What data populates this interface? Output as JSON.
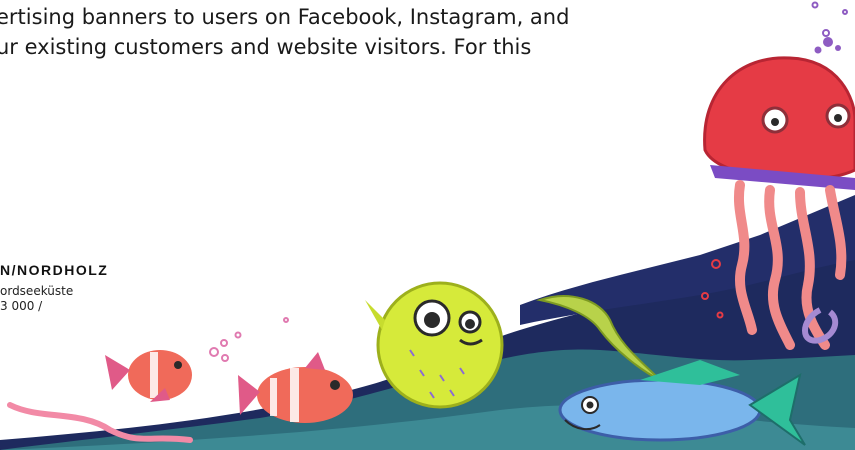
{
  "body_text": {
    "line1": "ertising banners to users on Facebook, Instagram, and",
    "line2": "ur existing customers and website visitors. For this"
  },
  "brand": {
    "title": "N/NORDHOLZ",
    "subtitle_line1": "ordseeküste",
    "subtitle_line2": "3 000 /"
  },
  "colors": {
    "wave_dark": "#1e2a5e",
    "wave_teal": "#2e6e7c",
    "wave_light": "#3d8a94",
    "jellyfish_red": "#e53b45",
    "jellyfish_tentacle": "#f08a8a",
    "pufferfish": "#d6ea3a",
    "clownfish": "#f06a5a",
    "bluefish": "#7ab6ec"
  },
  "illustration": {
    "icon": "sea-creatures-illustration"
  }
}
